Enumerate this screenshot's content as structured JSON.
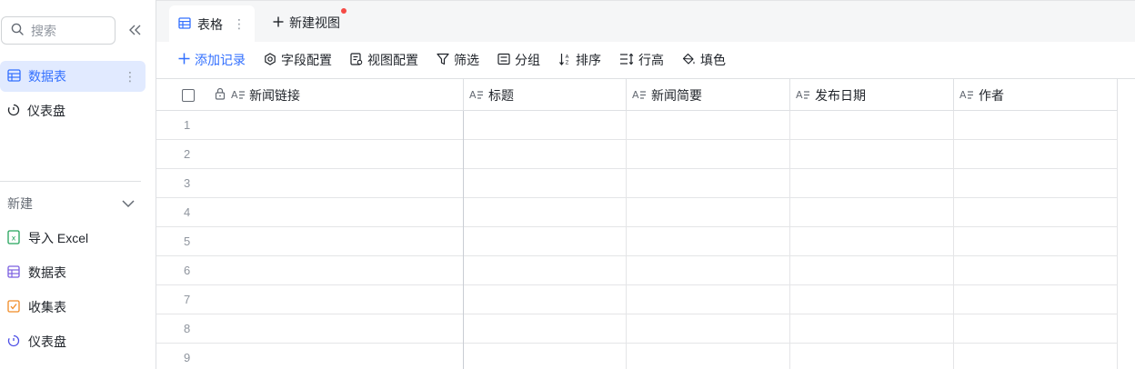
{
  "sidebar": {
    "search_placeholder": "搜索",
    "items": [
      {
        "label": "数据表",
        "more": "⋮"
      },
      {
        "label": "仪表盘"
      }
    ],
    "create": {
      "title": "新建",
      "items": [
        {
          "label": "导入 Excel",
          "icon": "excel-icon"
        },
        {
          "label": "数据表",
          "icon": "table-icon"
        },
        {
          "label": "收集表",
          "icon": "form-icon"
        },
        {
          "label": "仪表盘",
          "icon": "dashboard-icon"
        }
      ]
    }
  },
  "tabs": {
    "active_label": "表格",
    "new_view_label": "新建视图"
  },
  "toolbar": {
    "add_record": "添加记录",
    "field_config": "字段配置",
    "view_config": "视图配置",
    "filter": "筛选",
    "group": "分组",
    "sort": "排序",
    "row_height": "行高",
    "fill_color": "填色"
  },
  "grid": {
    "columns": [
      "新闻链接",
      "标题",
      "新闻简要",
      "发布日期",
      "作者"
    ],
    "rows": [
      "1",
      "2",
      "3",
      "4",
      "5",
      "6",
      "7",
      "8",
      "9"
    ]
  },
  "colors": {
    "accent": "#3370ff",
    "active_bg": "#e1eaff",
    "excel": "#23a35a",
    "table": "#7b5fe0",
    "form": "#f08a24",
    "dashboard": "#4c4ee6",
    "notify_dot": "#f54a45"
  }
}
